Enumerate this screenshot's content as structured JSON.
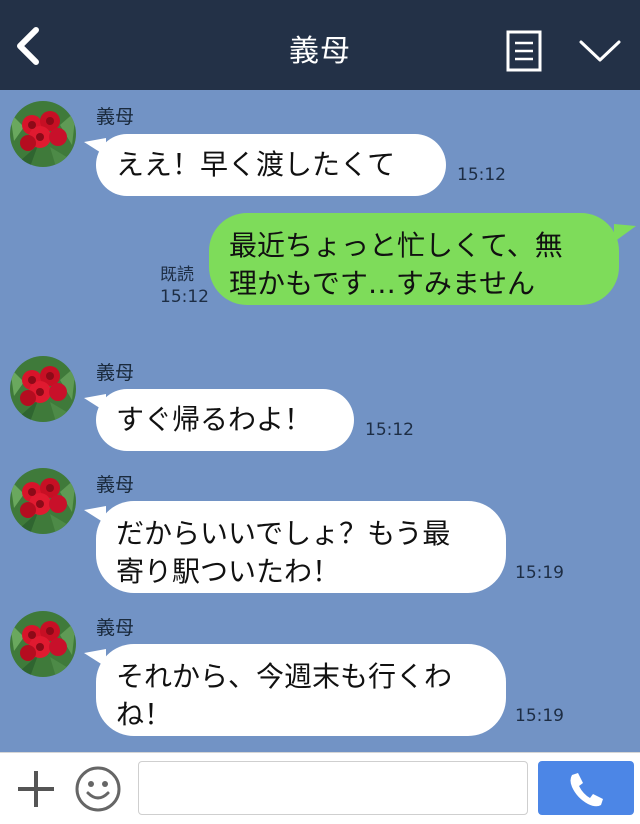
{
  "header": {
    "title": "義母"
  },
  "messages": [
    {
      "sender": "義母",
      "text": "ええ！早く渡したくて",
      "time": "15:12"
    },
    {
      "sender": "me",
      "line1": "最近ちょっと忙しくて、無",
      "line2": "理かもです…すみません",
      "read_label": "既読",
      "time": "15:12"
    },
    {
      "sender": "義母",
      "text": "すぐ帰るわよ！",
      "time": "15:12"
    },
    {
      "sender": "義母",
      "line1": "だからいいでしょ？もう最",
      "line2": "寄り駅ついたわ！",
      "time": "15:19"
    },
    {
      "sender": "義母",
      "line1": "それから、今週末も行くわ",
      "line2": "ね！",
      "time": "15:19"
    }
  ],
  "footer": {
    "input_placeholder": ""
  },
  "colors": {
    "header_bg": "#233147",
    "chat_bg": "#7293c5",
    "my_bubble": "#7edc5a",
    "their_bubble": "#ffffff",
    "call_button": "#4c86e6"
  }
}
